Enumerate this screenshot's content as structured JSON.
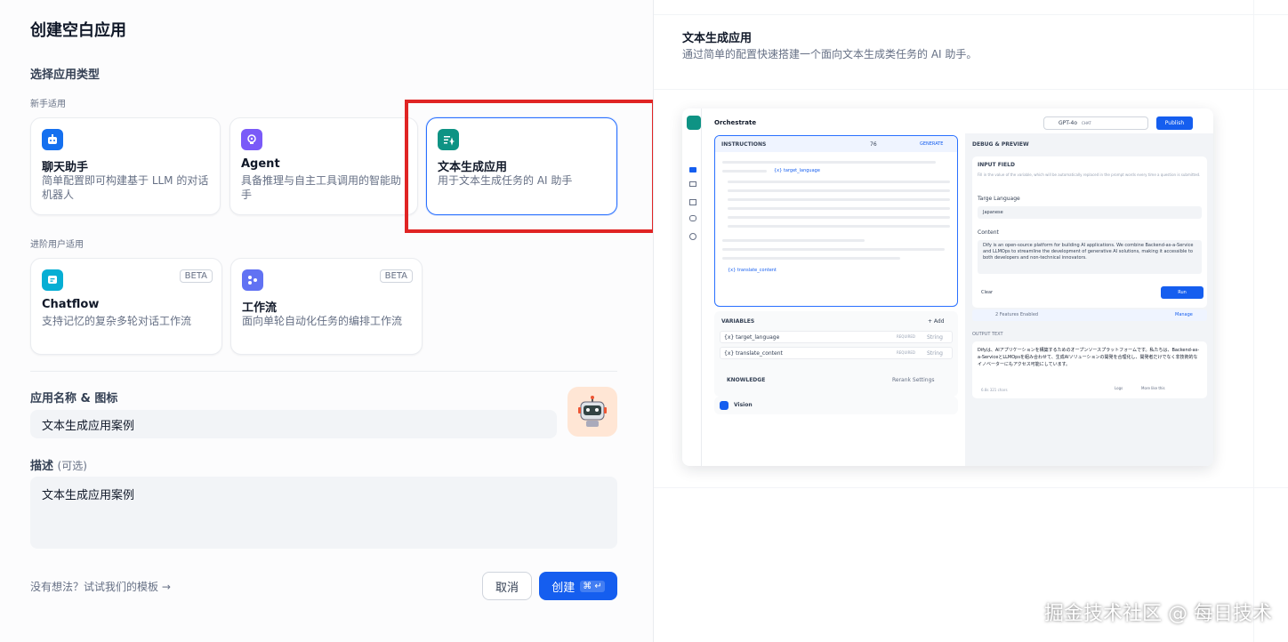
{
  "page": {
    "title": "创建空白应用",
    "type_label": "选择应用类型",
    "beginner_label": "新手适用",
    "advanced_label": "进阶用户适用"
  },
  "apps": [
    {
      "title": "聊天助手",
      "desc": "简单配置即可构建基于 LLM 的对话机器人"
    },
    {
      "title": "Agent",
      "desc": "具备推理与自主工具调用的智能助手"
    },
    {
      "title": "文本生成应用",
      "desc": "用于文本生成任务的 AI 助手"
    },
    {
      "title": "Chatflow",
      "desc": "支持记忆的复杂多轮对话工作流",
      "badge": "BETA"
    },
    {
      "title": "工作流",
      "desc": "面向单轮自动化任务的编排工作流",
      "badge": "BETA"
    }
  ],
  "form": {
    "name_label": "应用名称 & 图标",
    "name_value": "文本生成应用案例",
    "desc_label": "描述",
    "desc_optional": "(可选)",
    "desc_value": "文本生成应用案例"
  },
  "footer": {
    "template_link": "没有想法？试试我们的模板",
    "template_arrow": "→",
    "cancel": "取消",
    "create": "创建",
    "shortcut": "⌘ ↵"
  },
  "preview": {
    "title": "文本生成应用",
    "desc": "通过简单的配置快速搭建一个面向文本生成类任务的 AI 助手。",
    "shot": {
      "orchestrate": "Orchestrate",
      "model": "GPT-4o",
      "model_tag": "CHAT",
      "publish": "Publish",
      "instructions": "INSTRUCTIONS",
      "generate": "GENERATE",
      "var_chip1": "{x} target_language",
      "var_chip2": "{x} translate_content",
      "count": "76",
      "variables": "VARIABLES",
      "add": "+ Add",
      "var1": "{x} target_language",
      "var2": "{x} translate_content",
      "required": "REQUIRED",
      "string": "String",
      "knowledge": "KNOWLEDGE",
      "rerank": "Rerank Settings",
      "vision": "Vision",
      "debug": "DEBUG & PREVIEW",
      "input_field": "INPUT FIELD",
      "input_hint": "Fill in the value of the variable, which will be automatically replaced in the prompt words every time a question is submitted.",
      "targe_lang": "Targe Language",
      "japanese": "Japanese",
      "content": "Content",
      "content_text": "Dify is an open-source platform for building AI applications. We combine Backend-as-a-Service and LLMOps to streamline the development of generative AI solutions, making it accessible to both developers and non-technical innovators.",
      "clear": "Clear",
      "run": "Run",
      "features": "2 Features Enabled",
      "manage": "Manage",
      "output_label": "OUTPUT TEXT",
      "output_text": "Difyは、AIアプリケーションを構築するためのオープンソースプラットフォームです。私たちは、Backend-as-a-ServiceとLLMOpsを組み合わせて、生成AIソリューションの開発を合理化し、開発者だけでなく非技術的なイノベーターにもアクセス可能にしています。",
      "logs": "Logs",
      "more": "More like this",
      "stats": "6.8s  321 chars"
    }
  },
  "watermark": "掘金技术社区 @ 每日技术"
}
